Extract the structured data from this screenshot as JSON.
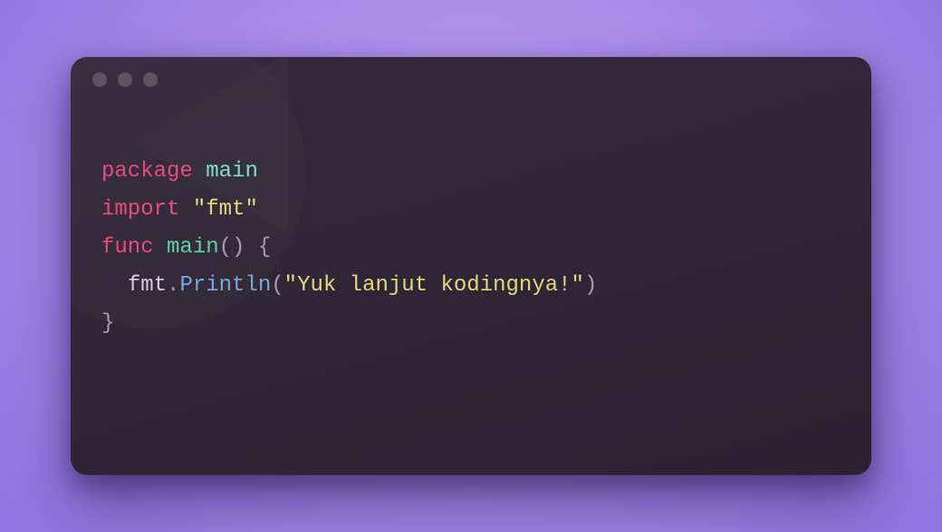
{
  "code": {
    "line1": {
      "kw_package": "package",
      "sp1": " ",
      "ident_main": "main"
    },
    "line2": {
      "kw_import": "import",
      "sp1": " ",
      "str_fmt": "\"fmt\""
    },
    "line3": "",
    "line4": {
      "kw_func": "func",
      "sp1": " ",
      "ident_main": "main",
      "parens": "()",
      "sp2": " ",
      "brace_open": "{"
    },
    "line5": {
      "indent": "  ",
      "obj_fmt": "fmt",
      "dot": ".",
      "method": "Println",
      "paren_open": "(",
      "str": "\"Yuk lanjut kodingnya!\"",
      "paren_close": ")"
    },
    "line6": {
      "brace_close": "}"
    }
  }
}
